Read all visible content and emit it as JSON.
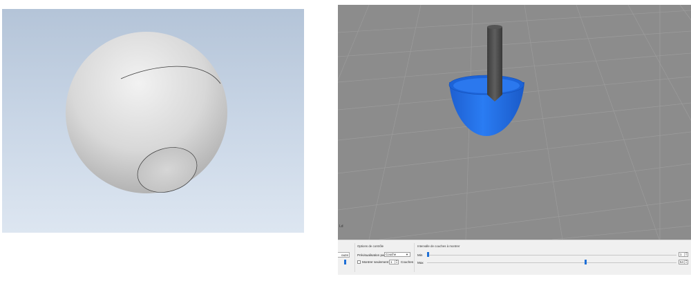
{
  "left_view": {
    "background_top": "#b4c4d8",
    "background_bottom": "#dde6f1",
    "model_color": "#d9d9d9"
  },
  "right_view": {
    "background": "#8c8c8c",
    "part_color": "#1e6fe8",
    "pin_color": "#4a4a4a",
    "corner_mark": "Ld"
  },
  "panel": {
    "stub_button_label": "ouze",
    "control_options": {
      "title": "Options de contrôle",
      "preview_by_label": "Prévisualisation par",
      "preview_by_value": "Couche",
      "show_only_label": "Montrer seulement",
      "show_only_value": "1",
      "layers_label": "Couches",
      "show_only_checked": false
    },
    "layer_range": {
      "title": "Intervalle de couches à montrer",
      "min_label": "Min",
      "min_value": "1",
      "min_fraction": 0.0,
      "max_label": "Max",
      "max_value": "54",
      "max_fraction": 0.637
    },
    "accent_color": "#1e6fd6"
  }
}
